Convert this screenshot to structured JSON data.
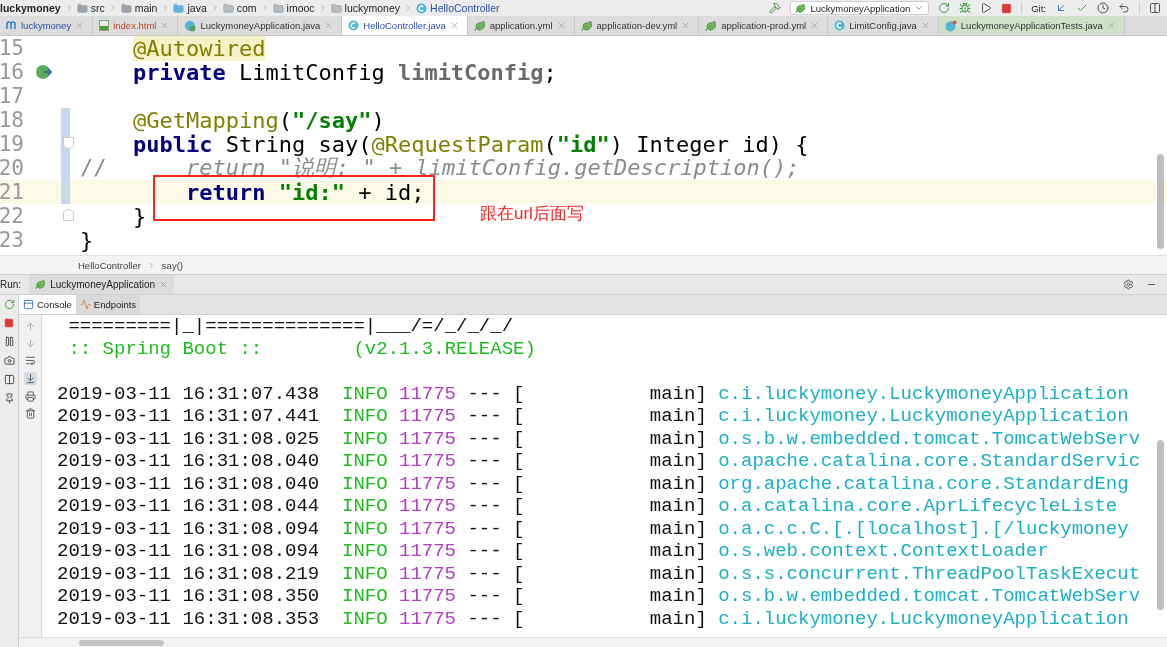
{
  "navigation": {
    "crumbs": [
      {
        "label": "luckymoney",
        "kind": "project"
      },
      {
        "label": "src",
        "kind": "folder"
      },
      {
        "label": "main",
        "kind": "folder"
      },
      {
        "label": "java",
        "kind": "source"
      },
      {
        "label": "com",
        "kind": "package"
      },
      {
        "label": "imooc",
        "kind": "package"
      },
      {
        "label": "luckymoney",
        "kind": "package"
      },
      {
        "label": "HelloController",
        "kind": "class"
      }
    ]
  },
  "toolbar": {
    "run_config": "LuckymoneyApplication",
    "git_label": "Git:"
  },
  "tabs": [
    {
      "label": "luckymoney",
      "kind": "module",
      "selected": false,
      "modified": true,
      "error": false
    },
    {
      "label": "index.html",
      "kind": "html",
      "selected": false,
      "modified": false,
      "error": true
    },
    {
      "label": "LuckymoneyApplication.java",
      "kind": "spring-class",
      "selected": false,
      "modified": false,
      "error": false
    },
    {
      "label": "HelloController.java",
      "kind": "class",
      "selected": true,
      "modified": true,
      "error": false
    },
    {
      "label": "application.yml",
      "kind": "spring",
      "selected": false,
      "modified": false,
      "error": false
    },
    {
      "label": "application-dev.yml",
      "kind": "spring",
      "selected": false,
      "modified": false,
      "error": false
    },
    {
      "label": "application-prod.yml",
      "kind": "spring",
      "selected": false,
      "modified": false,
      "error": false
    },
    {
      "label": "LimitConfig.java",
      "kind": "class",
      "selected": false,
      "modified": false,
      "error": false
    },
    {
      "label": "LuckymoneyApplicationTests.java",
      "kind": "test",
      "selected": false,
      "modified": false,
      "error": false
    }
  ],
  "editor": {
    "lines": [
      {
        "number": "15",
        "tokens": [
          {
            "kind": "marked-annotation",
            "text": "    @Autowired"
          }
        ]
      },
      {
        "number": "16",
        "bean_marker": true,
        "tokens": [
          {
            "kind": "keyword",
            "text": "    private"
          },
          {
            "kind": "plain",
            "text": " LimitConfig "
          },
          {
            "kind": "field",
            "text": "limitConfig"
          },
          {
            "kind": "plain",
            "text": ";"
          }
        ]
      },
      {
        "number": "17"
      },
      {
        "number": "18",
        "changed": true,
        "tokens": [
          {
            "kind": "annotation",
            "text": "    @GetMapping"
          },
          {
            "kind": "plain",
            "text": "("
          },
          {
            "kind": "string",
            "text": "\"/say\""
          },
          {
            "kind": "plain",
            "text": ")"
          }
        ]
      },
      {
        "number": "19",
        "changed": true,
        "fold_start": true,
        "tokens": [
          {
            "kind": "keyword",
            "text": "    public"
          },
          {
            "kind": "plain",
            "text": " String say("
          },
          {
            "kind": "annotation",
            "text": "@RequestParam"
          },
          {
            "kind": "plain",
            "text": "("
          },
          {
            "kind": "string",
            "text": "\"id\""
          },
          {
            "kind": "plain",
            "text": ") Integer id) {"
          }
        ]
      },
      {
        "number": "20",
        "changed": true,
        "tokens": [
          {
            "kind": "comment-mark",
            "text": "//"
          },
          {
            "kind": "comment",
            "text": "      return \"说明: \" + limitConfig.getDescription();"
          }
        ]
      },
      {
        "number": "21",
        "changed": true,
        "current": true,
        "tokens": [
          {
            "kind": "keyword",
            "text": "        return"
          },
          {
            "kind": "string",
            "text": " \"id:\""
          },
          {
            "kind": "plain",
            "text": " + id;"
          }
        ]
      },
      {
        "number": "22",
        "fold_end": true,
        "tokens": [
          {
            "kind": "plain",
            "text": "    }"
          }
        ]
      },
      {
        "number": "23",
        "tokens": [
          {
            "kind": "plain",
            "text": "}"
          }
        ]
      }
    ],
    "callout": "跟在url后面写",
    "breadcrumbs": [
      "HelloController",
      "say()"
    ]
  },
  "run_panel": {
    "label": "Run:",
    "tab": "LuckymoneyApplication",
    "tabs": [
      {
        "label": "Console",
        "kind": "console",
        "selected": true
      },
      {
        "label": "Endpoints",
        "kind": "endpoints",
        "selected": false
      }
    ],
    "banner": [
      " =========|_|==============|___/=/_/_/_/",
      " :: Spring Boot ::        (v2.1.3.RELEASE)"
    ],
    "log": [
      {
        "time": "2019-03-11 16:31:07.438",
        "level": "INFO",
        "pid": "11775",
        "sep": "--- [",
        "thread": "main]",
        "logger": "c.i.luckymoney.LuckymoneyApplication"
      },
      {
        "time": "2019-03-11 16:31:07.441",
        "level": "INFO",
        "pid": "11775",
        "sep": "--- [",
        "thread": "main]",
        "logger": "c.i.luckymoney.LuckymoneyApplication"
      },
      {
        "time": "2019-03-11 16:31:08.025",
        "level": "INFO",
        "pid": "11775",
        "sep": "--- [",
        "thread": "main]",
        "logger": "o.s.b.w.embedded.tomcat.TomcatWebServ"
      },
      {
        "time": "2019-03-11 16:31:08.040",
        "level": "INFO",
        "pid": "11775",
        "sep": "--- [",
        "thread": "main]",
        "logger": "o.apache.catalina.core.StandardServic"
      },
      {
        "time": "2019-03-11 16:31:08.040",
        "level": "INFO",
        "pid": "11775",
        "sep": "--- [",
        "thread": "main]",
        "logger": "org.apache.catalina.core.StandardEng"
      },
      {
        "time": "2019-03-11 16:31:08.044",
        "level": "INFO",
        "pid": "11775",
        "sep": "--- [",
        "thread": "main]",
        "logger": "o.a.catalina.core.AprLifecycleListe"
      },
      {
        "time": "2019-03-11 16:31:08.094",
        "level": "INFO",
        "pid": "11775",
        "sep": "--- [",
        "thread": "main]",
        "logger": "o.a.c.c.C.[.[localhost].[/luckymoney"
      },
      {
        "time": "2019-03-11 16:31:08.094",
        "level": "INFO",
        "pid": "11775",
        "sep": "--- [",
        "thread": "main]",
        "logger": "o.s.web.context.ContextLoader"
      },
      {
        "time": "2019-03-11 16:31:08.219",
        "level": "INFO",
        "pid": "11775",
        "sep": "--- [",
        "thread": "main]",
        "logger": "o.s.s.concurrent.ThreadPoolTaskExecut"
      },
      {
        "time": "2019-03-11 16:31:08.350",
        "level": "INFO",
        "pid": "11775",
        "sep": "--- [",
        "thread": "main]",
        "logger": "o.s.b.w.embedded.tomcat.TomcatWebServ"
      },
      {
        "time": "2019-03-11 16:31:08.353",
        "level": "INFO",
        "pid": "11775",
        "sep": "--- [",
        "thread": "main]",
        "logger": "c.i.luckymoney.LuckymoneyApplication"
      }
    ]
  }
}
